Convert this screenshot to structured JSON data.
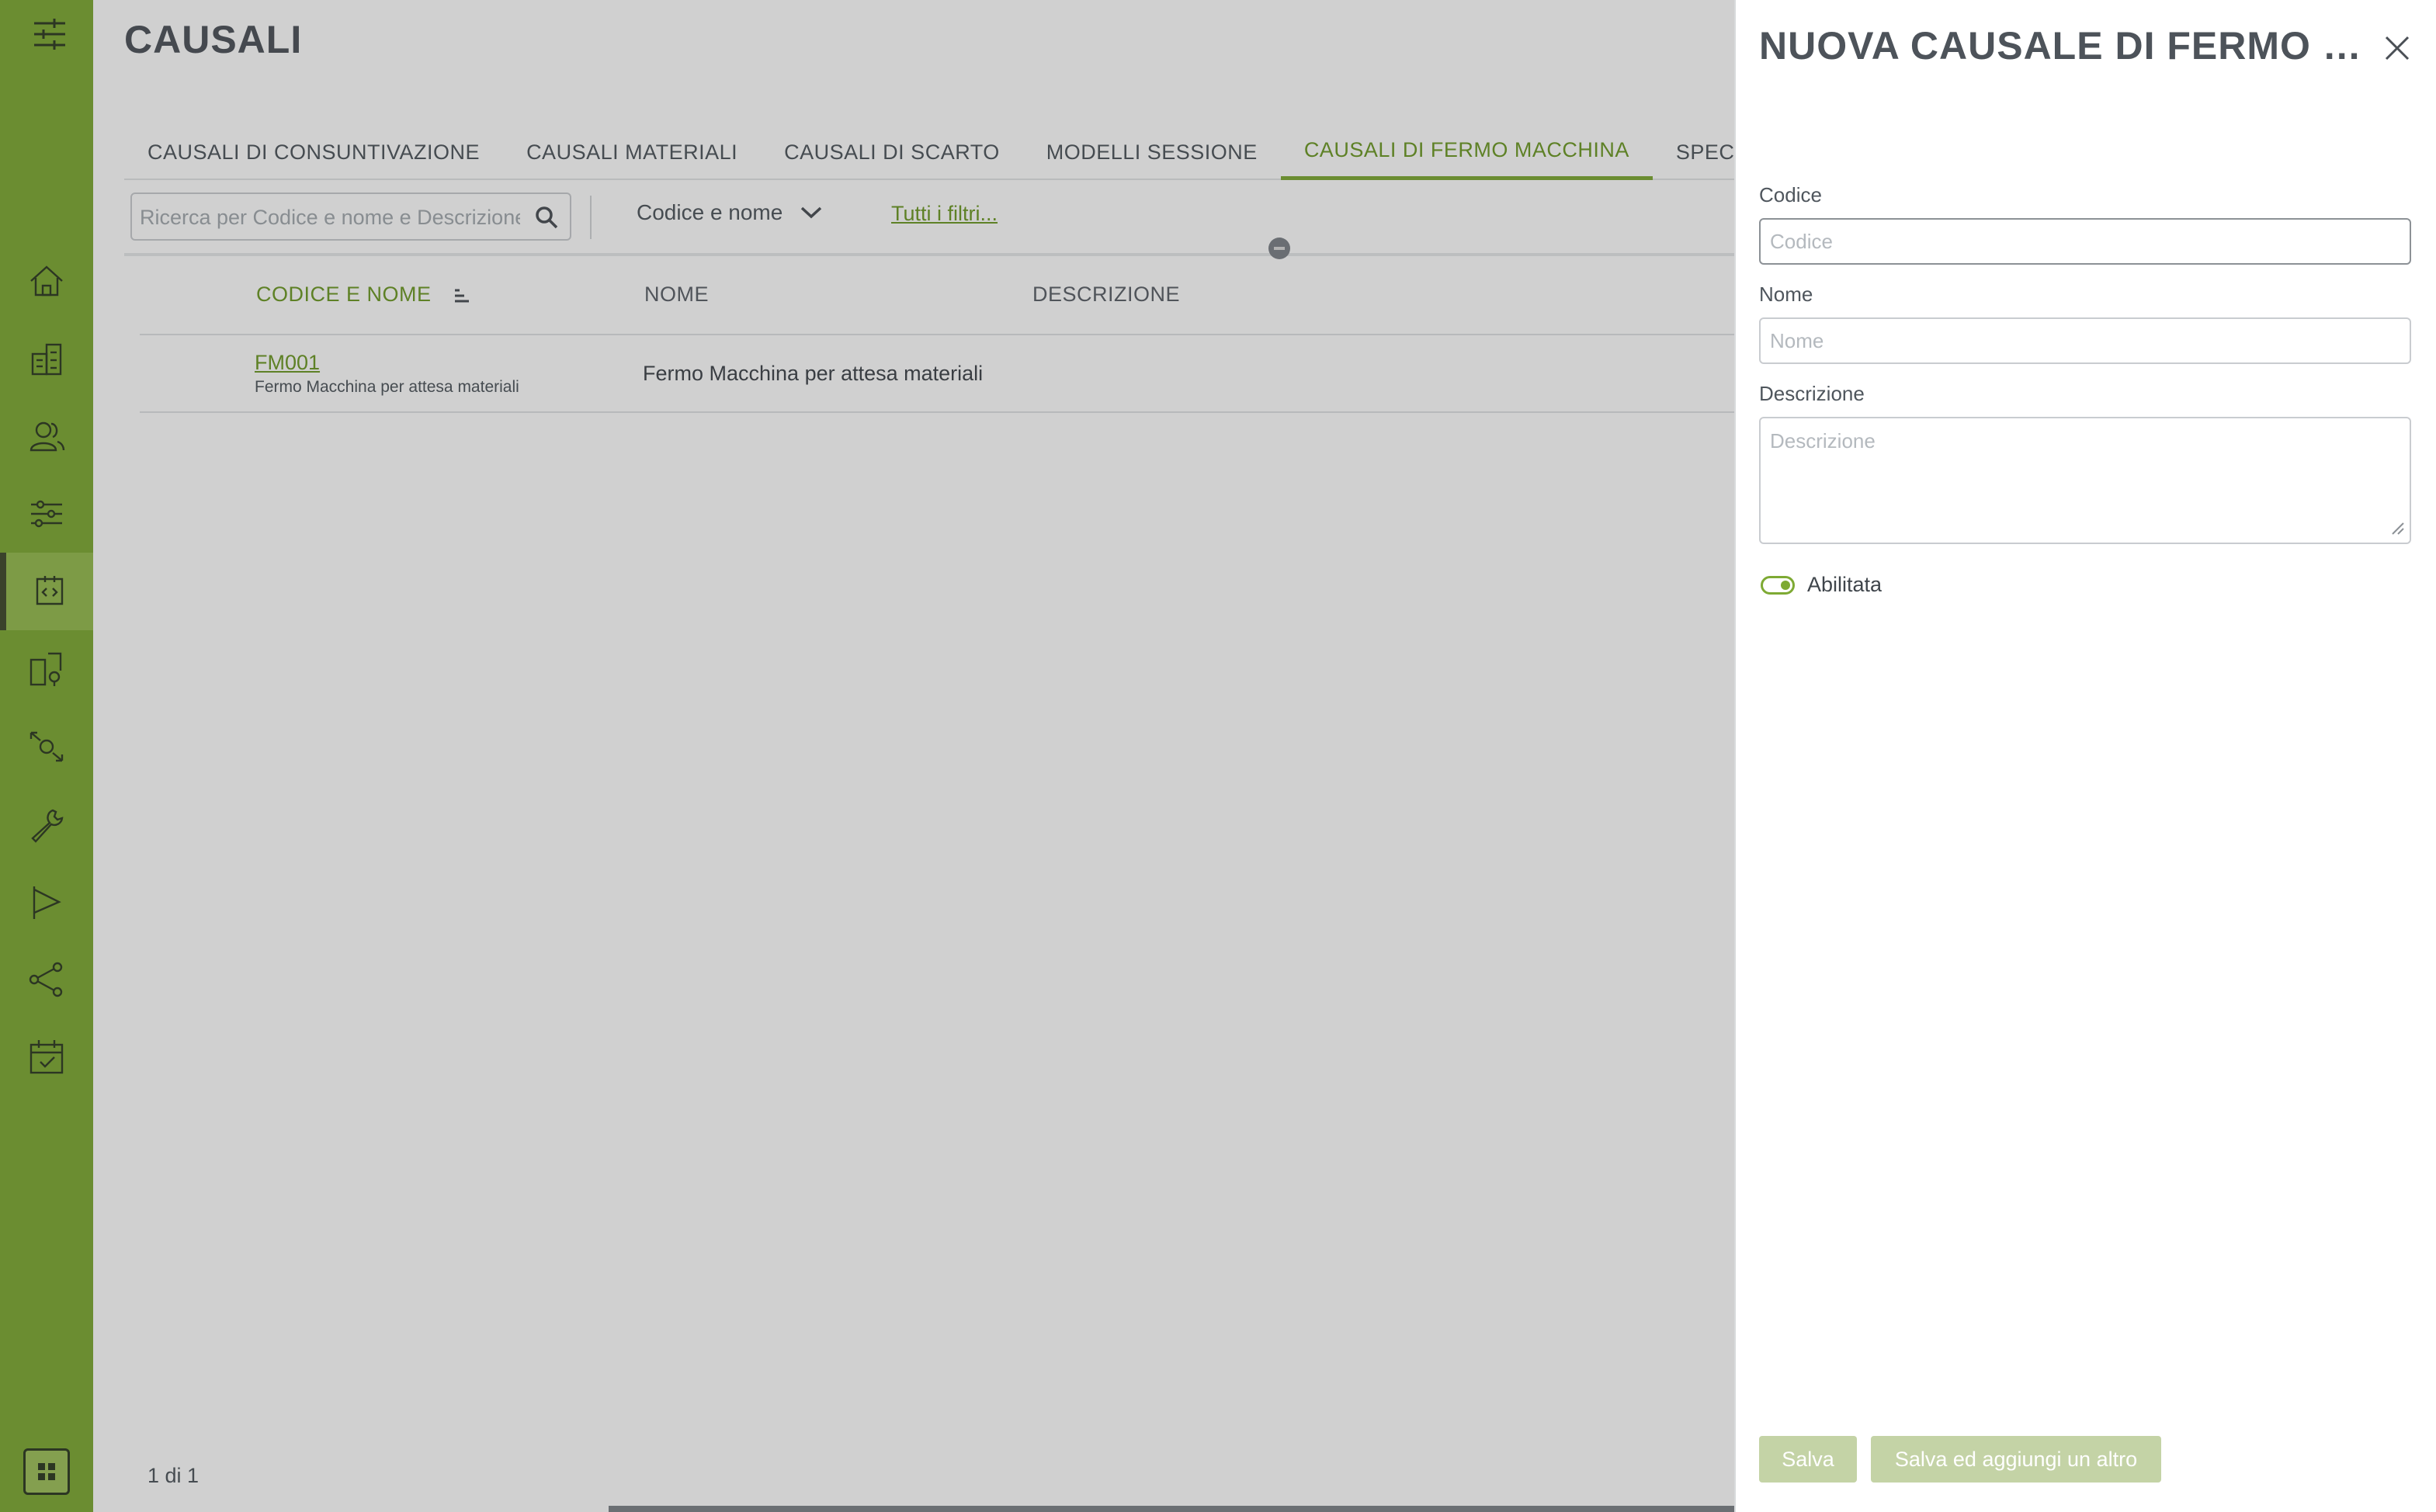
{
  "page": {
    "title": "CAUSALI"
  },
  "tabs": [
    {
      "label": "CAUSALI DI CONSUNTIVAZIONE",
      "active": false
    },
    {
      "label": "CAUSALI MATERIALI",
      "active": false
    },
    {
      "label": "CAUSALI DI SCARTO",
      "active": false
    },
    {
      "label": "MODELLI SESSIONE",
      "active": false
    },
    {
      "label": "CAUSALI DI FERMO MACCHINA",
      "active": true
    },
    {
      "label": "SPECIFICATORI",
      "active": false
    }
  ],
  "toolbar": {
    "search_placeholder": "Ricerca per Codice e nome e Descrizione",
    "sort_label": "Codice e nome",
    "filters_link": "Tutti i filtri..."
  },
  "table": {
    "columns": [
      "CODICE E NOME",
      "NOME",
      "DESCRIZIONE"
    ],
    "rows": [
      {
        "code": "FM001",
        "code_sub": "Fermo Macchina per attesa materiali",
        "name": "Fermo Macchina per attesa materiali",
        "description": ""
      }
    ],
    "footer_count": "1 di 1"
  },
  "sidebar": {
    "items": [
      {
        "icon": "home-icon"
      },
      {
        "icon": "building-icon"
      },
      {
        "icon": "users-icon"
      },
      {
        "icon": "sliders-icon"
      },
      {
        "icon": "code-icon",
        "active": true
      },
      {
        "icon": "devices-icon"
      },
      {
        "icon": "process-icon"
      },
      {
        "icon": "wrench-icon"
      },
      {
        "icon": "flag-icon"
      },
      {
        "icon": "share-icon"
      },
      {
        "icon": "calendar-check-icon"
      }
    ]
  },
  "panel": {
    "title": "NUOVA CAUSALE DI FERMO MA...",
    "fields": {
      "code_label": "Codice",
      "code_placeholder": "Codice",
      "name_label": "Nome",
      "name_placeholder": "Nome",
      "description_label": "Descrizione",
      "description_placeholder": "Descrizione"
    },
    "toggle_label": "Abilitata",
    "toggle_on": true,
    "save_label": "Salva",
    "save_add_label": "Salva ed aggiungi un altro"
  },
  "colors": {
    "accent": "#7eaa34",
    "accent_text": "#6e9a26",
    "disabled_button": "#c4d3a6"
  }
}
